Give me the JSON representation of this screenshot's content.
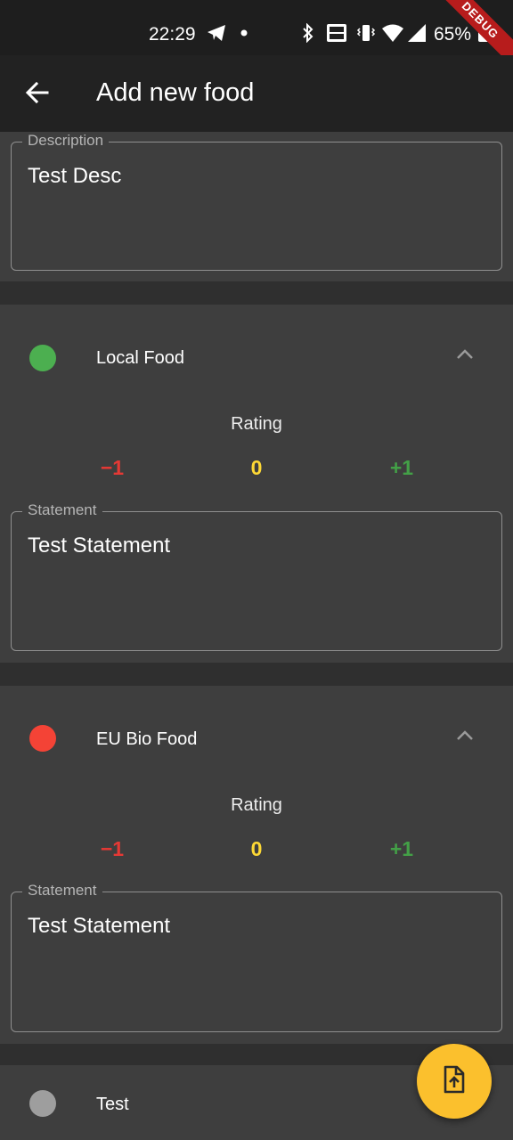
{
  "status": {
    "time": "22:29",
    "battery": "65%",
    "debug_label": "DEBUG"
  },
  "app_bar": {
    "title": "Add new food"
  },
  "description": {
    "label": "Description",
    "value": "Test Desc"
  },
  "categories": [
    {
      "name": "Local Food",
      "dot_color": "#4caf50",
      "rating_label": "Rating",
      "ratings": {
        "minus": "−1",
        "zero": "0",
        "plus": "+1"
      },
      "statement_label": "Statement",
      "statement_value": "Test Statement"
    },
    {
      "name": "EU Bio Food",
      "dot_color": "#f44336",
      "rating_label": "Rating",
      "ratings": {
        "minus": "−1",
        "zero": "0",
        "plus": "+1"
      },
      "statement_label": "Statement",
      "statement_value": "Test Statement"
    },
    {
      "name": "Test",
      "dot_color": "#9e9e9e"
    }
  ],
  "colors": {
    "minus": "#e53935",
    "zero": "#fdd835",
    "plus": "#43a047",
    "fab": "#fbc02d"
  },
  "icons": {
    "back": "arrow-back-icon",
    "chevron": "chevron-up-icon",
    "fab": "file-upload-icon"
  }
}
